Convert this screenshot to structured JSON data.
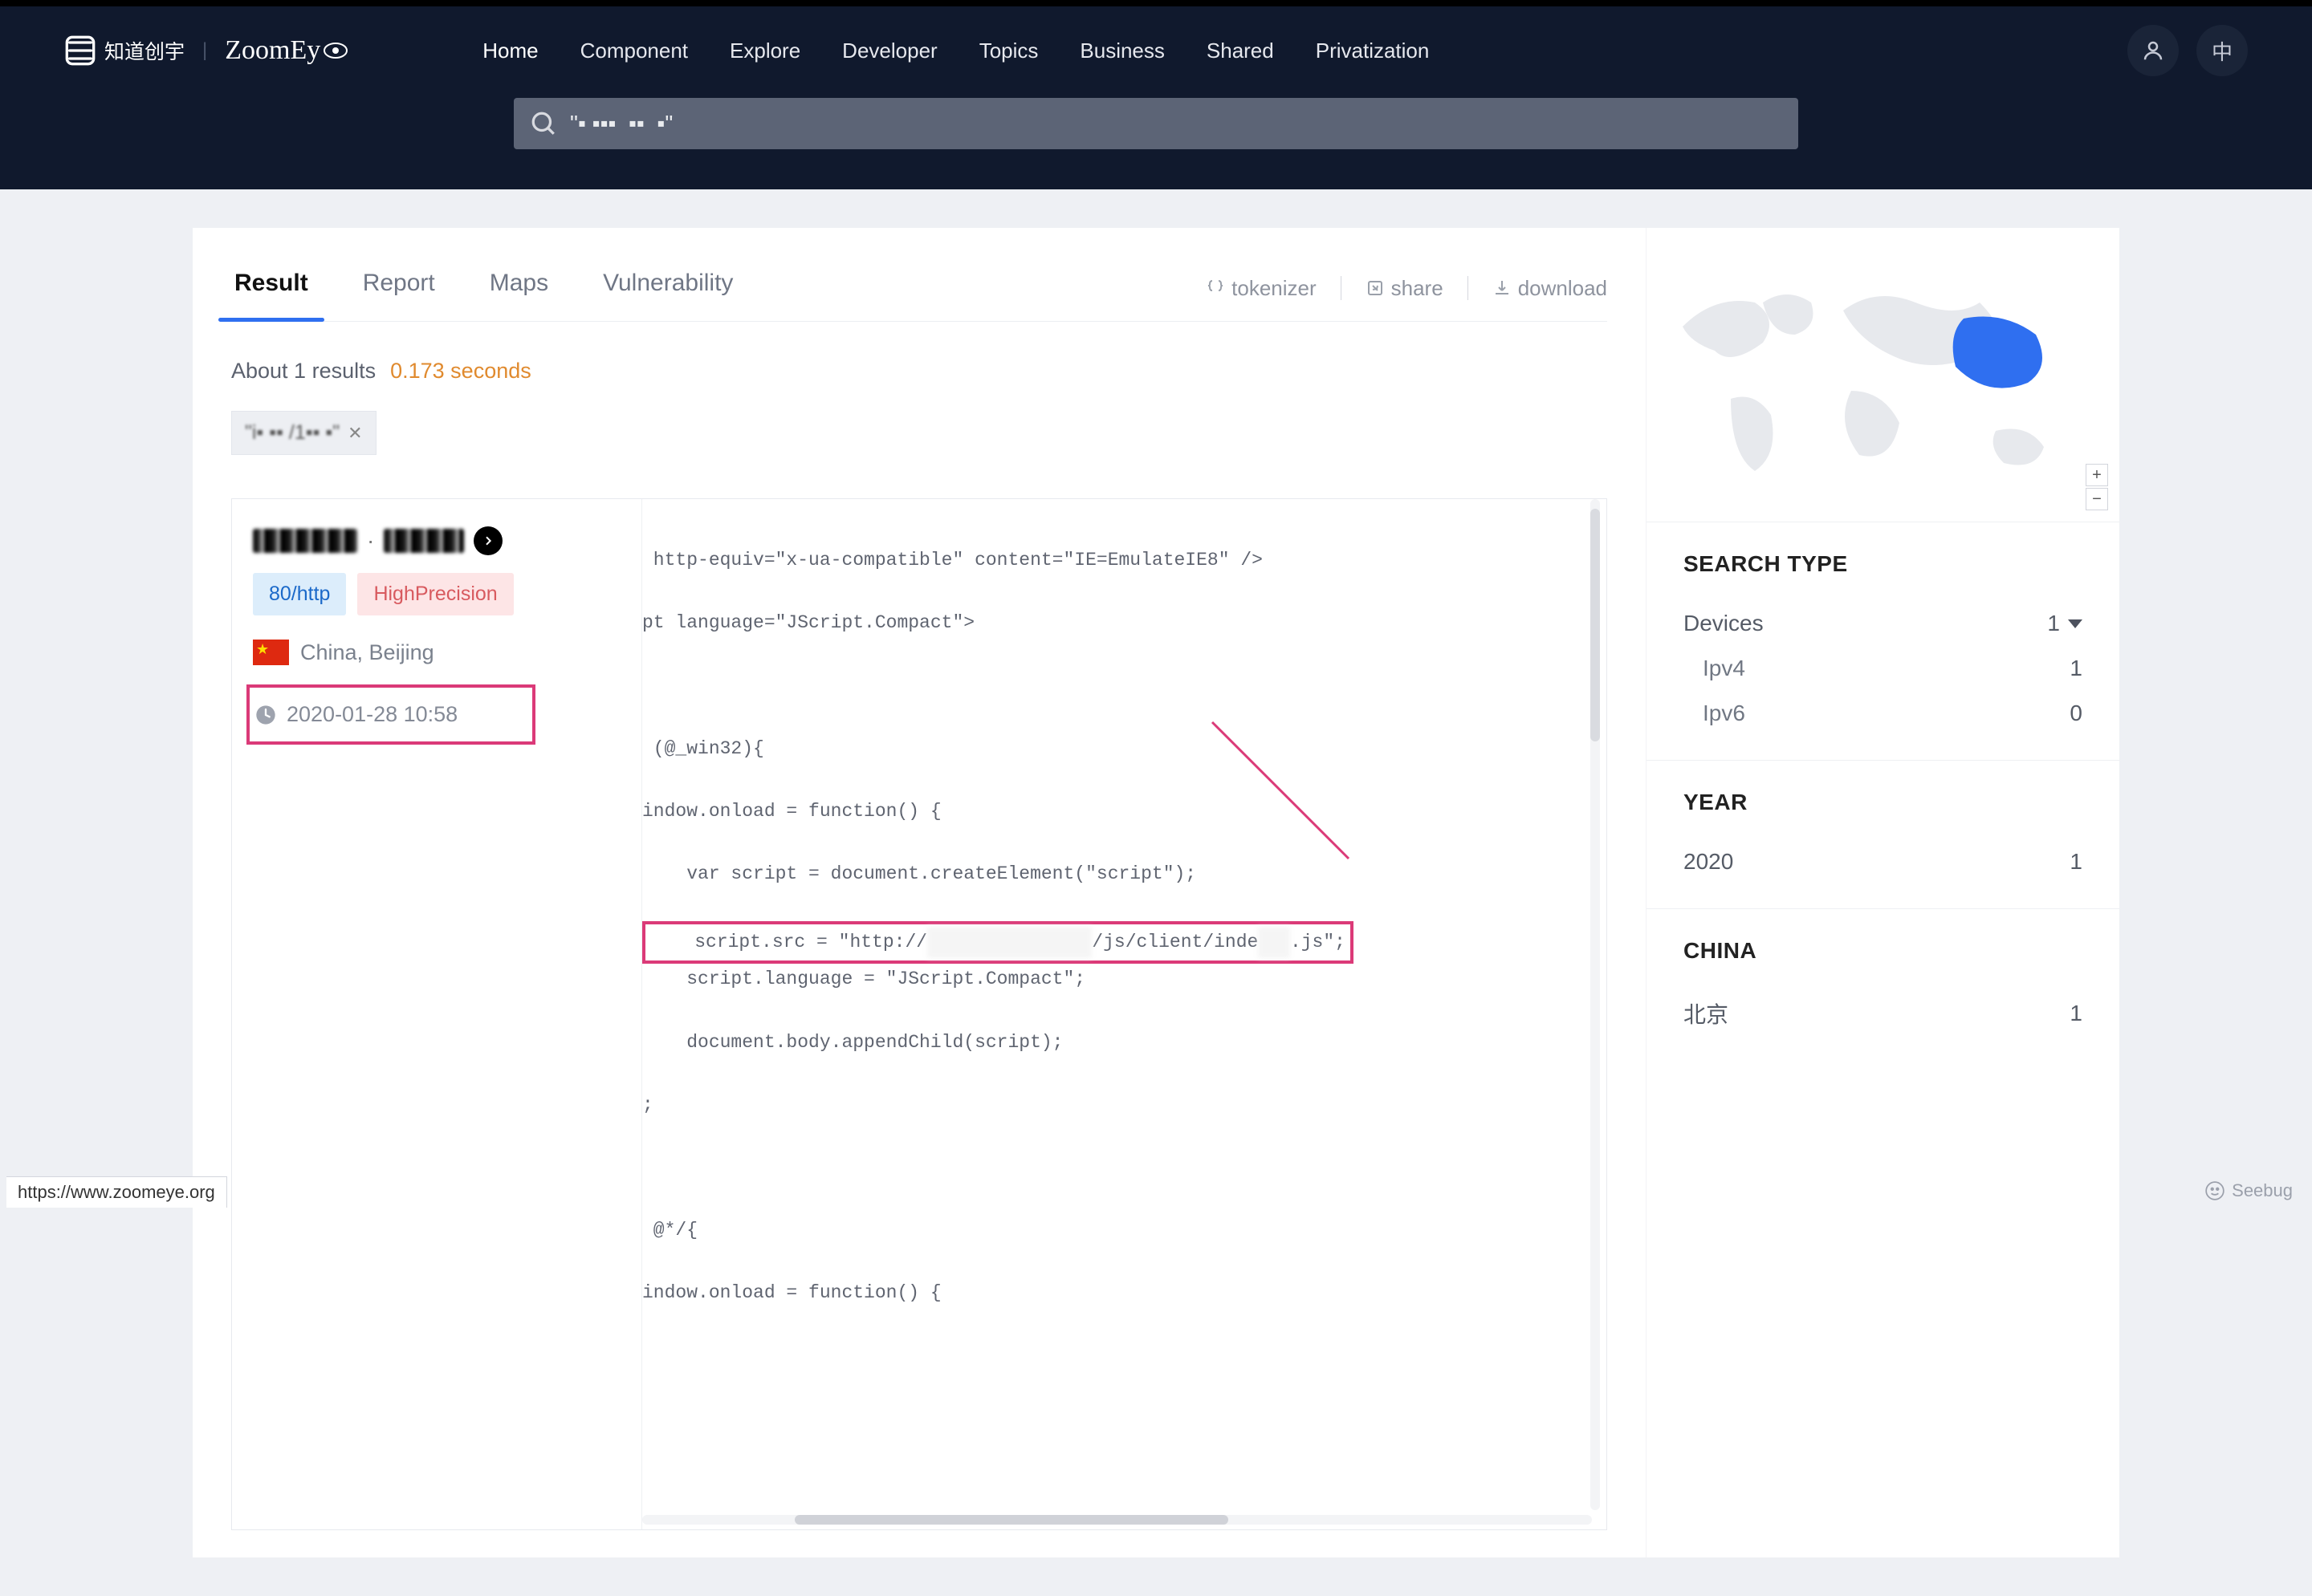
{
  "header": {
    "knownsec_text": "知道创宇",
    "zoomey_text": "ZoomEy",
    "nav": [
      "Home",
      "Component",
      "Explore",
      "Developer",
      "Topics",
      "Business",
      "Shared",
      "Privatization"
    ],
    "lang_label": "中"
  },
  "search": {
    "value": "\"▪ ▪▪▪  ▪▪  ▪\""
  },
  "tabs": {
    "result": "Result",
    "report": "Report",
    "maps": "Maps",
    "vulnerability": "Vulnerability"
  },
  "tab_actions": {
    "tokenizer": "tokenizer",
    "share": "share",
    "download": "download"
  },
  "meta": {
    "about": "About 1 results",
    "time": "0.173 seconds"
  },
  "chip": {
    "text": "\"i▪ ▪▪ /1▪▪ ▪\""
  },
  "result": {
    "port_tag": "80/http",
    "precision_tag": "HighPrecision",
    "location": "China, Beijing",
    "timestamp": "2020-01-28 10:58",
    "code_l1": " http-equiv=\"x-ua-compatible\" content=\"IE=EmulateIE8\" />",
    "code_l2": "pt language=\"JScript.Compact\">",
    "code_l3": " (@_win32){",
    "code_l4": "indow.onload = function() {",
    "code_l5": "    var script = document.createElement(\"script\");",
    "code_l6a": "    script.src = \"http://",
    "code_l6b": "/js/client/inde",
    "code_l6c": ".js\";",
    "code_l7": "    script.language = \"JScript.Compact\";",
    "code_l8": "    document.body.appendChild(script);",
    "code_l9": ";",
    "code_l10": " @*/{",
    "code_l11": "indow.onload = function() {"
  },
  "facets": {
    "search_type_title": "SEARCH TYPE",
    "devices_label": "Devices",
    "devices_count": "1",
    "ipv4_label": "Ipv4",
    "ipv4_count": "1",
    "ipv6_label": "Ipv6",
    "ipv6_count": "0",
    "year_title": "YEAR",
    "year_label": "2020",
    "year_count": "1",
    "china_title": "CHINA",
    "china_label": "北京",
    "china_count": "1"
  },
  "statusbar": "https://www.zoomeye.org",
  "seebug": "Seebug"
}
